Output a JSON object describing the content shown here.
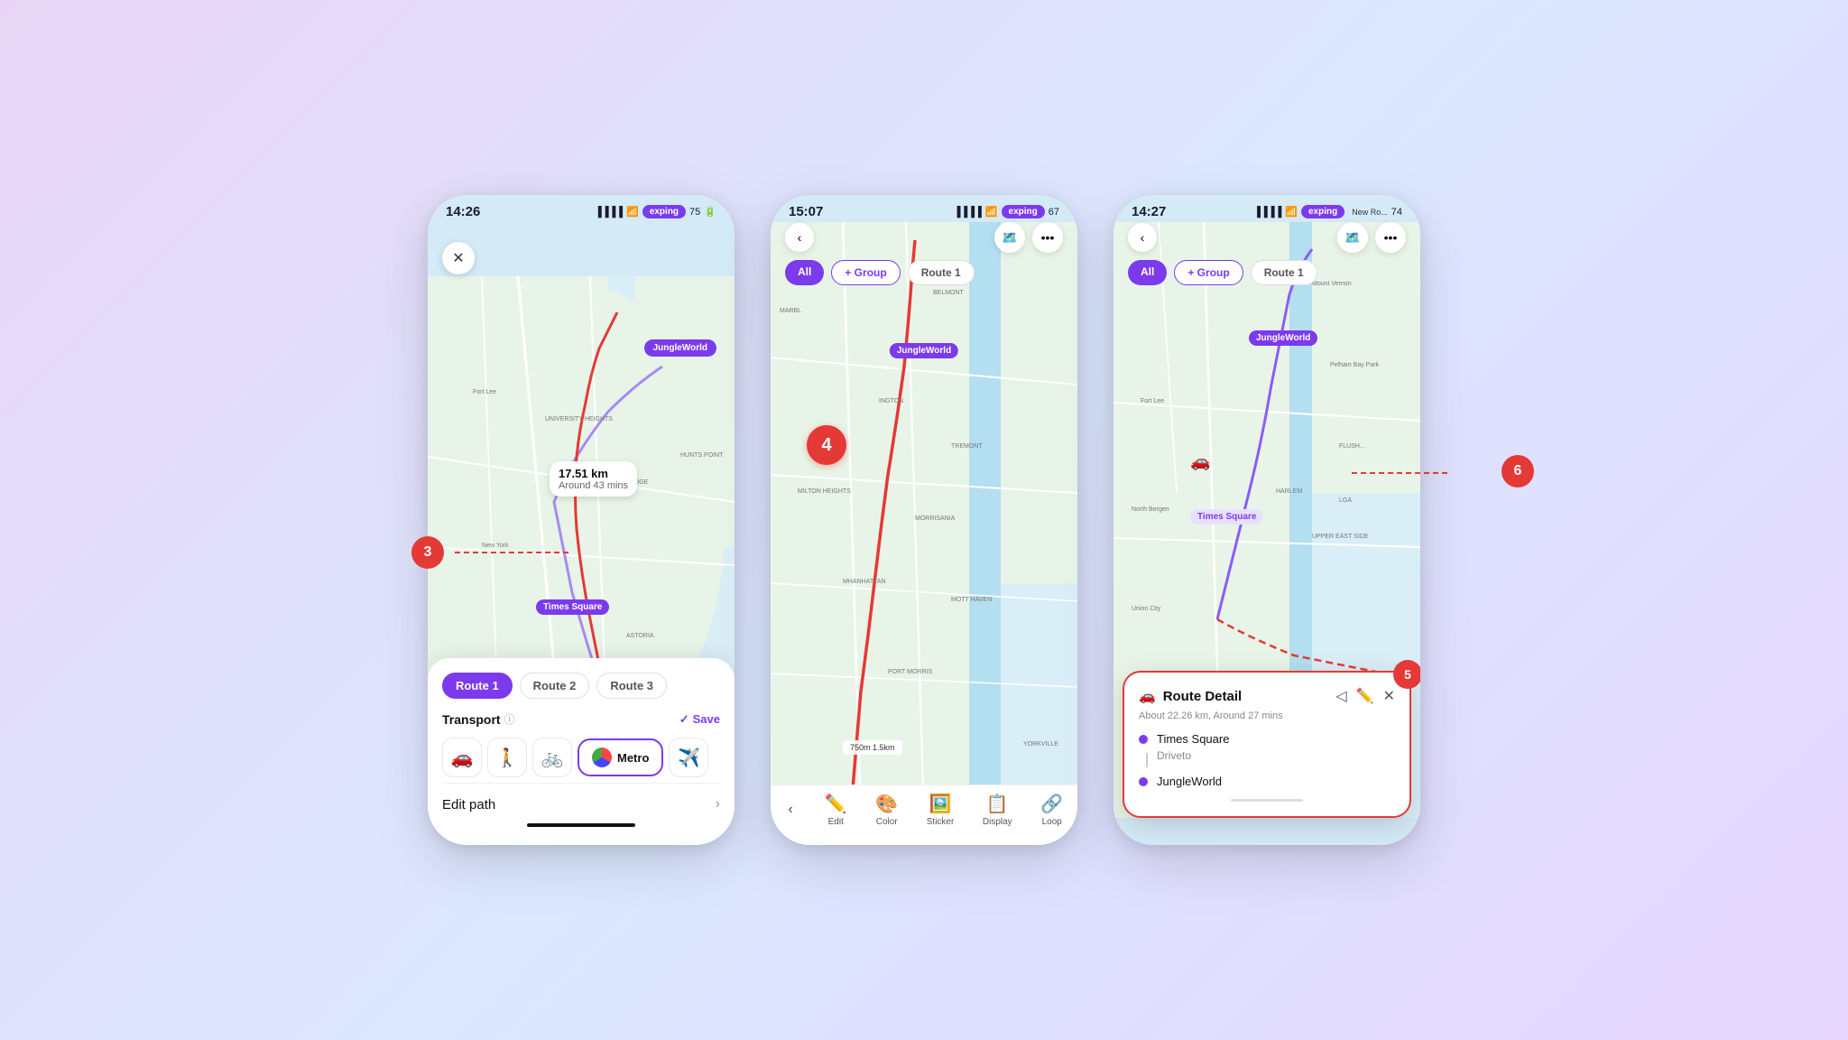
{
  "page": {
    "background": "lavender gradient"
  },
  "phone1": {
    "status": {
      "time": "14:26",
      "app_name": "exping",
      "battery": "75"
    },
    "map": {
      "location_pin": "JungleWorld"
    },
    "distance_bubble": {
      "km": "17.51 km",
      "mins": "Around 43 mins"
    },
    "times_square_pin": "Times Square",
    "route_tabs": [
      {
        "label": "Route 1",
        "active": true
      },
      {
        "label": "Route 2",
        "active": false
      },
      {
        "label": "Route 3",
        "active": false
      }
    ],
    "transport": {
      "label": "Transport",
      "save_label": "Save"
    },
    "transport_modes": [
      {
        "icon": "🚗",
        "active": false
      },
      {
        "icon": "🚶",
        "active": false
      },
      {
        "icon": "🚲",
        "active": false
      },
      {
        "icon": "Metro",
        "active": true
      },
      {
        "icon": "✈️",
        "active": false
      }
    ],
    "edit_path": "Edit path"
  },
  "phone2": {
    "status": {
      "time": "15:07",
      "app_name": "exping"
    },
    "filters": {
      "all": "All",
      "group": "+ Group",
      "route1": "Route 1"
    },
    "number_badge": "4",
    "location_pins": [
      "JungleWorld"
    ],
    "toolbar": {
      "items": [
        {
          "icon": "✏️",
          "label": "Edit"
        },
        {
          "icon": "🎨",
          "label": "Color"
        },
        {
          "icon": "🖼️",
          "label": "Sticker"
        },
        {
          "icon": "📋",
          "label": "Display"
        },
        {
          "icon": "🔗",
          "label": "Loop"
        }
      ]
    },
    "scale_bar": "750m   1.5km"
  },
  "phone3": {
    "status": {
      "time": "14:27",
      "app_name": "exping",
      "new_route": "New Ro..."
    },
    "filters": {
      "all": "All",
      "group": "+ Group",
      "route1": "Route 1"
    },
    "location_pins": [
      "JungleWorld",
      "Times Square"
    ],
    "route_detail": {
      "title": "Route Detail",
      "subtitle": "About 22.26 km, Around 27 mins",
      "waypoints": [
        {
          "label": "Times Square",
          "type": "origin"
        },
        {
          "label": "Driveto",
          "type": "via"
        },
        {
          "label": "JungleWorld",
          "type": "destination"
        }
      ],
      "actions": [
        "navigate",
        "edit",
        "close"
      ]
    }
  },
  "annotations": {
    "circle3": "3",
    "circle5": "5",
    "circle6": "6"
  }
}
